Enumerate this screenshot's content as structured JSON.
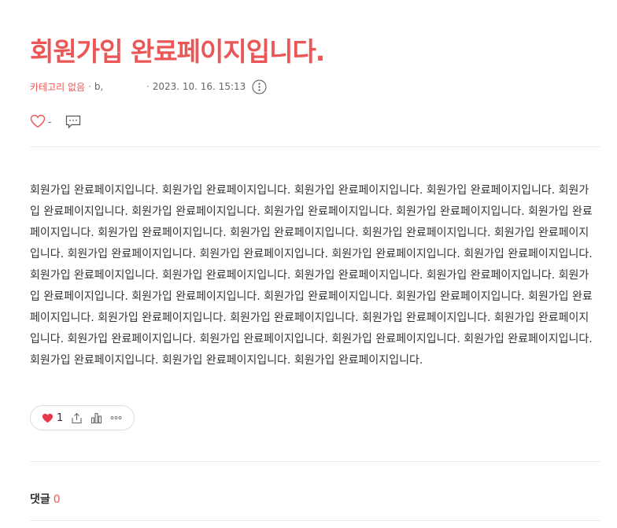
{
  "post": {
    "title": "회원가입 완료페이지입니다.",
    "category": "카테고리 없음",
    "separator": "·",
    "author": "b,",
    "date": "2023. 10. 16. 15:13",
    "like_count_top": "-",
    "body": "회원가입 완료페이지입니다. 회원가입 완료페이지입니다. 회원가입 완료페이지입니다. 회원가입 완료페이지입니다. 회원가입 완료페이지입니다. 회원가입 완료페이지입니다. 회원가입 완료페이지입니다. 회원가입 완료페이지입니다. 회원가입 완료페이지입니다. 회원가입 완료페이지입니다. 회원가입 완료페이지입니다. 회원가입 완료페이지입니다. 회원가입 완료페이지입니다. 회원가입 완료페이지입니다. 회원가입 완료페이지입니다. 회원가입 완료페이지입니다. 회원가입 완료페이지입니다. 회원가입 완료페이지입니다. 회원가입 완료페이지입니다. 회원가입 완료페이지입니다. 회원가입 완료페이지입니다. 회원가입 완료페이지입니다. 회원가입 완료페이지입니다. 회원가입 완료페이지입니다. 회원가입 완료페이지입니다. 회원가입 완료페이지입니다. 회원가입 완료페이지입니다. 회원가입 완료페이지입니다. 회원가입 완료페이지입니다. 회원가입 완료페이지입니다. 회원가입 완료페이지입니다. 회원가입 완료페이지입니다. 회원가입 완료페이지입니다. 회원가입 완료페이지입니다. 회원가입 완료페이지입니다. 회원가입 완료페이지입니다. 회원가입 완료페이지입니다."
  },
  "reactions": {
    "like_count": "1"
  },
  "comments": {
    "label": "댓글",
    "count": "0"
  },
  "icons": {
    "more": "more-vertical-circle-icon",
    "heart_outline": "heart-outline-icon",
    "comment": "comment-icon",
    "heart_filled": "heart-filled-icon",
    "share": "share-icon",
    "stats": "stats-icon",
    "more_horizontal": "more-horizontal-icon"
  },
  "colors": {
    "accent": "#eb5757",
    "text": "#333333",
    "muted": "#666666",
    "divider": "#ebebeb",
    "heart": "#e8364a"
  }
}
